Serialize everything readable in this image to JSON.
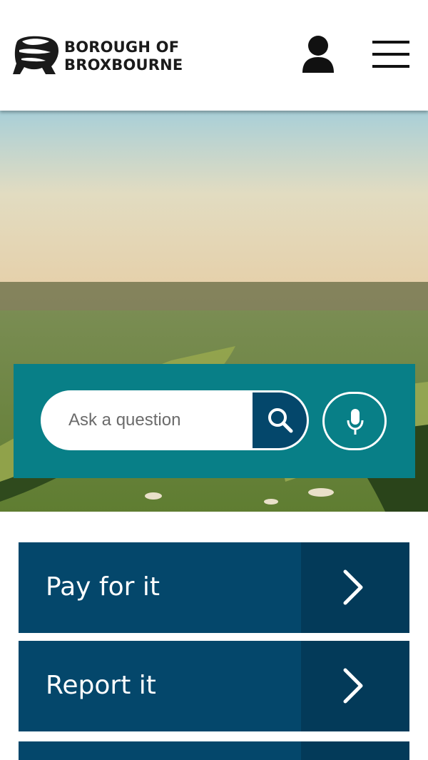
{
  "header": {
    "logo_line1": "BOROUGH OF",
    "logo_line2": "BROXBOURNE",
    "account_icon": "person-icon",
    "menu_icon": "hamburger-menu-icon"
  },
  "hero": {
    "search": {
      "placeholder": "Ask a question",
      "search_icon": "search-icon",
      "mic_icon": "microphone-icon"
    }
  },
  "tasks": [
    {
      "label": "Pay for it",
      "icon": "chevron-right-icon"
    },
    {
      "label": "Report it",
      "icon": "chevron-right-icon"
    },
    {
      "label": "",
      "icon": ""
    }
  ],
  "colors": {
    "navy": "#04476b",
    "navy_dark": "#033a59",
    "teal": "#087f87",
    "white": "#ffffff"
  }
}
